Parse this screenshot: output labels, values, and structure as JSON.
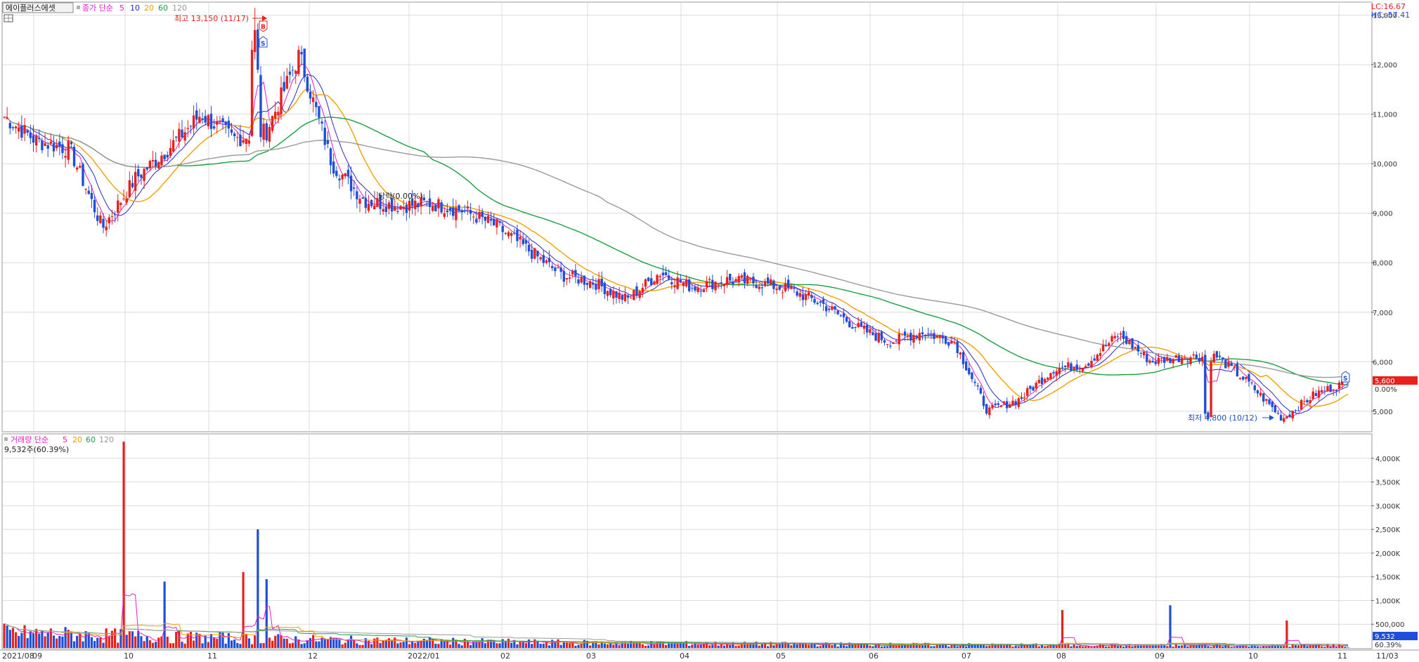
{
  "stock": {
    "name": "에이플러스에셋",
    "price_legend": {
      "label": "종가 단순",
      "periods": [
        "5",
        "10",
        "20",
        "60",
        "120"
      ]
    },
    "volume_legend": {
      "label": "거래량 단순",
      "periods": [
        "5",
        "20",
        "60",
        "120"
      ]
    },
    "volume_info": "9,532주(60.39%)",
    "lc": "LC:16.67",
    "hc": "HC:-57.41",
    "high_label": "최고 13,150 (11/17)",
    "low_label": "최저 4,800 (10/12)",
    "event_label": "당락(0.00%)",
    "current_price": "5,600",
    "current_change": "0.00%",
    "current_volume": "9,532",
    "current_volume_pct": "60.39%",
    "colors": {
      "up": "#e8211d",
      "down": "#1f4fd8",
      "ma5": "#e020c0",
      "ma10": "#2828c8",
      "ma20": "#f0a000",
      "ma60": "#18a040",
      "ma120": "#9a9a9a",
      "grid": "#dcdcdc"
    }
  },
  "chart_data": [
    {
      "type": "candlestick",
      "y_ticks": [
        "13,000",
        "12,000",
        "11,000",
        "10,000",
        "9,000",
        "8,000",
        "7,000",
        "6,000",
        "5,000"
      ],
      "x_ticks": [
        "2021/08",
        "09",
        "10",
        "11",
        "12",
        "2022/01",
        "02",
        "03",
        "04",
        "05",
        "06",
        "07",
        "08",
        "09",
        "10",
        "11",
        "11/03"
      ],
      "ylim": [
        4600,
        13250
      ],
      "grid": true,
      "weekly_close": [
        10950,
        10450,
        10300,
        8700,
        9700,
        10300,
        11000,
        10500,
        10650,
        12200,
        10000,
        9250,
        9150,
        9200,
        9050,
        8750,
        8250,
        7750,
        7600,
        7250,
        7800,
        7500,
        7650,
        7600,
        7450,
        7150,
        6700,
        6400,
        6600,
        6400,
        5000,
        5250,
        5850,
        5950,
        6550,
        6000,
        6100,
        6100,
        5550,
        4850,
        5350,
        5600
      ],
      "high": 13150,
      "low": 4800,
      "last_price": 5600
    },
    {
      "type": "bar",
      "y_ticks": [
        "4,000K",
        "3,500K",
        "3,000K",
        "2,500K",
        "2,000K",
        "1,500K",
        "1,000K",
        "500,000"
      ],
      "ylim": [
        0,
        4500000
      ],
      "grid": true,
      "spikes": [
        {
          "index": 41,
          "value": 4350000
        },
        {
          "index": 87,
          "value": 2500000
        },
        {
          "index": 82,
          "value": 1600000
        },
        {
          "index": 55,
          "value": 1400000
        },
        {
          "index": 90,
          "value": 1450000
        },
        {
          "index": 363,
          "value": 800000
        },
        {
          "index": 400,
          "value": 900000
        },
        {
          "index": 440,
          "value": 580000
        },
        {
          "index": 461,
          "value": 520000
        }
      ],
      "last_value": 9532
    }
  ]
}
